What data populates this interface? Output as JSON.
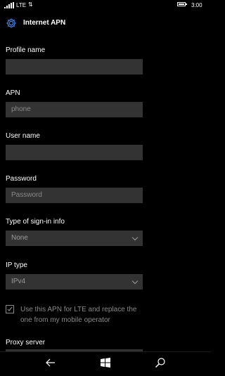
{
  "status_bar": {
    "network": "LTE",
    "time": "3:00"
  },
  "header": {
    "title": "Internet APN"
  },
  "fields": {
    "profile_name": {
      "label": "Profile name",
      "value": "",
      "placeholder": ""
    },
    "apn": {
      "label": "APN",
      "value": "",
      "placeholder": "phone"
    },
    "user_name": {
      "label": "User name",
      "value": "",
      "placeholder": ""
    },
    "password": {
      "label": "Password",
      "value": "",
      "placeholder": "Password"
    },
    "sign_in_type": {
      "label": "Type of sign-in info",
      "value": "None"
    },
    "ip_type": {
      "label": "IP type",
      "value": "IPv4"
    },
    "proxy": {
      "label": "Proxy server"
    }
  },
  "lte_checkbox": {
    "checked": true,
    "text": "Use this APN for LTE and replace the one from my mobile operator"
  },
  "icons": {
    "settings": "gear-icon",
    "back": "back-arrow-icon",
    "home": "windows-logo-icon",
    "search": "search-icon"
  }
}
